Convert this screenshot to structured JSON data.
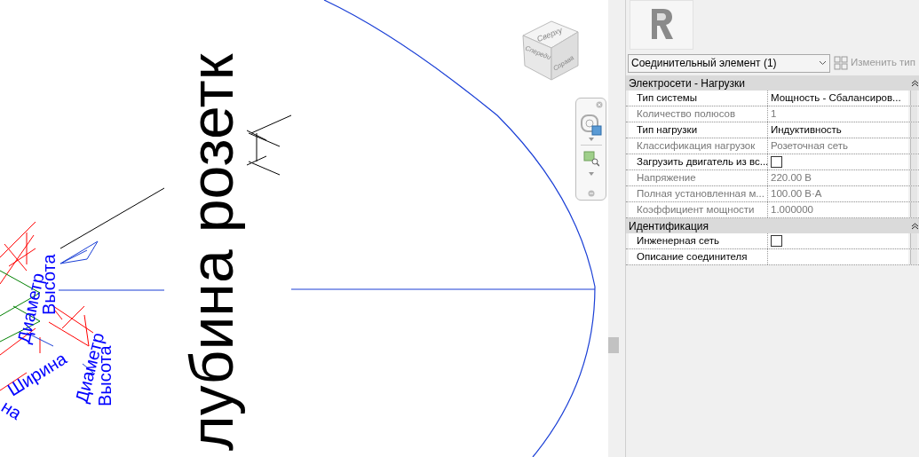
{
  "canvas": {
    "labels": [
      {
        "text": "лубина розетк",
        "kind": "large"
      },
      {
        "text": "Высота",
        "kind": "tag"
      },
      {
        "text": "Диаметр",
        "kind": "tag"
      },
      {
        "text": "Диаметр",
        "kind": "tag"
      },
      {
        "text": "Высота",
        "kind": "tag"
      },
      {
        "text": "Ширина",
        "kind": "tag"
      },
      {
        "text": "на",
        "kind": "tag"
      }
    ]
  },
  "view_cube": {
    "faces": [
      "Сверху",
      "Спереди",
      "Справа"
    ]
  },
  "properties": {
    "type_selector": "Соединительный элемент (1)",
    "edit_type": {
      "label": "Изменить тип",
      "disabled": true
    },
    "groups": [
      {
        "title": "Электросети - Нагрузки",
        "expanded": true,
        "rows": [
          {
            "kind": "text",
            "name": "Тип системы",
            "value": "Мощность - Сбалансиров...",
            "editable": true
          },
          {
            "kind": "text",
            "name": "Количество полюсов",
            "value": "1",
            "editable": false
          },
          {
            "kind": "text",
            "name": "Тип нагрузки",
            "value": "Индуктивность",
            "editable": true
          },
          {
            "kind": "text",
            "name": "Классификация нагрузок",
            "value": "Розеточная сеть",
            "editable": false
          },
          {
            "kind": "checkbox",
            "name": "Загрузить двигатель из вс...",
            "checked": false,
            "editable": true
          },
          {
            "kind": "text",
            "name": "Напряжение",
            "value": "220.00 В",
            "editable": false
          },
          {
            "kind": "text",
            "name": "Полная установленная м...",
            "value": "100.00 В·А",
            "editable": false
          },
          {
            "kind": "text",
            "name": "Коэффициент мощности",
            "value": "1.000000",
            "editable": false
          }
        ]
      },
      {
        "title": "Идентификация",
        "expanded": true,
        "rows": [
          {
            "kind": "checkbox",
            "name": "Инженерная сеть",
            "checked": false,
            "editable": true
          },
          {
            "kind": "text",
            "name": "Описание соединителя",
            "value": "",
            "editable": true
          }
        ]
      }
    ]
  }
}
